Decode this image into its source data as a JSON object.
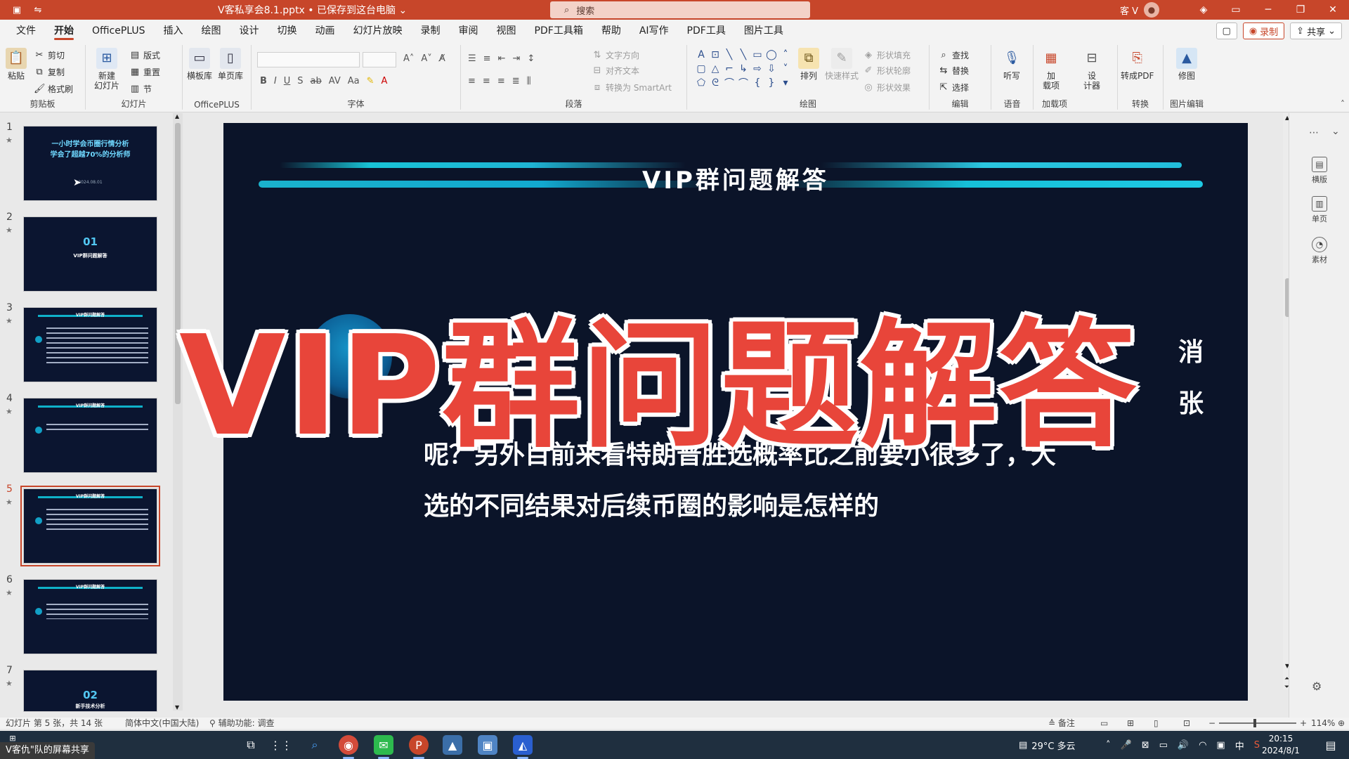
{
  "titlebar": {
    "doc_title": "V客私享会8.1.pptx • 已保存到这台电脑",
    "search_placeholder": "搜索",
    "user": "客 V",
    "minimize": "─",
    "restore": "❐",
    "close": "✕"
  },
  "menu": {
    "tabs": [
      "文件",
      "开始",
      "OfficePLUS",
      "插入",
      "绘图",
      "设计",
      "切换",
      "动画",
      "幻灯片放映",
      "录制",
      "审阅",
      "视图",
      "PDF工具箱",
      "帮助",
      "AI写作",
      "PDF工具",
      "图片工具"
    ],
    "active": "开始",
    "record": "录制",
    "share": "共享"
  },
  "ribbon": {
    "clipboard": {
      "paste": "粘贴",
      "cut": "剪切",
      "copy": "复制",
      "format_painter": "格式刷",
      "label": "剪贴板"
    },
    "slides": {
      "new_slide": "新建\n幻灯片",
      "layout": "版式",
      "reset": "重置",
      "section": "节",
      "label": "幻灯片"
    },
    "officeplus": {
      "template_lib": "横板库",
      "single_page": "单页库",
      "label": "OfficePLUS"
    },
    "font": {
      "label": "字体"
    },
    "paragraph": {
      "text_direction": "文字方向",
      "align_text": "对齐文本",
      "convert_smartart": "转换为 SmartArt",
      "label": "段落"
    },
    "drawing": {
      "arrange": "排列",
      "quick_styles": "快速样式",
      "shape_fill": "形状填充",
      "shape_outline": "形状轮廓",
      "shape_effects": "形状效果",
      "label": "绘图"
    },
    "editing": {
      "find": "查找",
      "replace": "替换",
      "select": "选择",
      "label": "编辑"
    },
    "voice": {
      "dictate": "听写",
      "label": "语音"
    },
    "addins": {
      "addins": "加\n载项",
      "label": "加载项"
    },
    "designer": {
      "designer": "设\n计器"
    },
    "convert": {
      "to_pdf": "转成PDF",
      "label": "转换"
    },
    "picture_edit": {
      "retouch": "修图",
      "label": "图片编辑"
    }
  },
  "thumbnails": {
    "slides": [
      {
        "num": "1",
        "title": "一小时学会币圈行情分析\n学会了超越70%的分析师",
        "sub": "2024.08.01"
      },
      {
        "num": "2",
        "big": "01",
        "sub": "VIP群问题解答"
      },
      {
        "num": "3",
        "title": "VIP群问题解答"
      },
      {
        "num": "4",
        "title": "VIP群问题解答"
      },
      {
        "num": "5",
        "title": "VIP群问题解答"
      },
      {
        "num": "6",
        "title": "VIP群问题解答"
      },
      {
        "num": "7",
        "big": "02",
        "sub": "新手技术分析"
      }
    ],
    "active": "5"
  },
  "slide": {
    "title": "VIP群问题解答",
    "lines": [
      "                                                                                          消",
      "                                                                                          张",
      "呢？另外目前来看特朗普胜选概率比之前要小很多了，大",
      "选的不同结果对后续币圈的影响是怎样的"
    ]
  },
  "overlay": {
    "caption": "VIP群问题解答"
  },
  "rightpane": {
    "items": [
      "横版",
      "单页",
      "素材"
    ]
  },
  "status": {
    "slide_info": "幻灯片 第 5 张，共 14 张",
    "language": "简体中文(中国大陆)",
    "accessibility": "辅助功能: 调查",
    "notes": "备注",
    "zoom": "114%"
  },
  "taskbar": {
    "share_label": "V客仇\"队的屏幕共享",
    "weather": "29°C 多云",
    "ime": "中",
    "time": "20:15",
    "date": "2024/8/1"
  },
  "colors": {
    "accent": "#c7462a",
    "slide_bg": "#0b1429",
    "overlay_red": "#e8453a",
    "cyan": "#18c3d6"
  }
}
